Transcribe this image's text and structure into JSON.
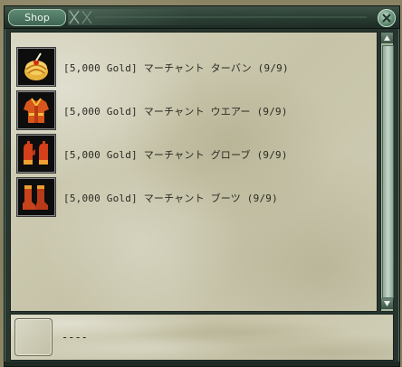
{
  "window": {
    "title": "Shop"
  },
  "items": [
    {
      "label": "[5,000 Gold] マーチャント ターバン (9/9)",
      "icon": "turban-icon"
    },
    {
      "label": "[5,000 Gold] マーチャント ウエアー (9/9)",
      "icon": "wear-icon"
    },
    {
      "label": "[5,000 Gold] マーチャント グローブ (9/9)",
      "icon": "gloves-icon"
    },
    {
      "label": "[5,000 Gold] マーチャント ブーツ (9/9)",
      "icon": "boots-icon"
    }
  ],
  "detail": {
    "text": "----"
  },
  "colors": {
    "frame": "#27352e",
    "panel": "#cfcdb5",
    "accent": "#5e8a73"
  }
}
